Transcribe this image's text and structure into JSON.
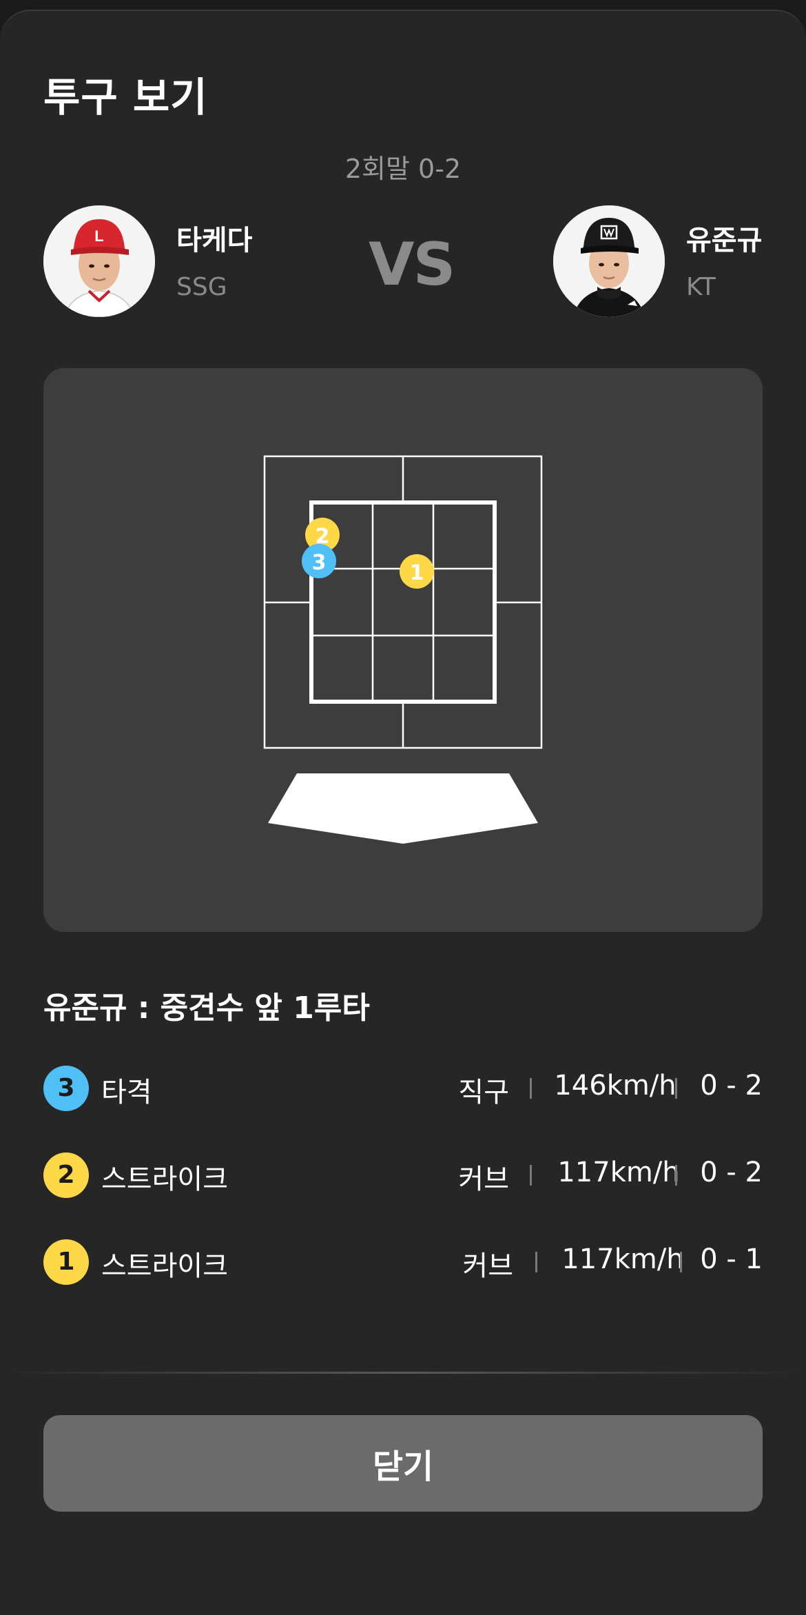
{
  "header": {
    "title": "투구 보기",
    "inning_score": "2회말 0-2"
  },
  "pitcher": {
    "name": "타케다",
    "team": "SSG"
  },
  "vs_label": "VS",
  "batter": {
    "name": "유준규",
    "team": "KT"
  },
  "zone_markers": [
    {
      "number": "2",
      "color": "#ffd848"
    },
    {
      "number": "3",
      "color": "#4fbff5"
    },
    {
      "number": "1",
      "color": "#ffd848"
    }
  ],
  "result_text": "유준규 : 중견수 앞 1루타",
  "pitches": [
    {
      "number": "3",
      "label": "타격",
      "type": "직구",
      "speed": "146km/h",
      "count": "0 - 2",
      "color": "#4fbff5"
    },
    {
      "number": "2",
      "label": "스트라이크",
      "type": "커브",
      "speed": "117km/h",
      "count": "0 - 2",
      "color": "#ffd848"
    },
    {
      "number": "1",
      "label": "스트라이크",
      "type": "커브",
      "speed": "117km/h",
      "count": "0 - 1",
      "color": "#ffd848"
    }
  ],
  "close_button": "닫기",
  "colors": {
    "background": "#262626",
    "panel": "#3d3d3d",
    "button": "#6b6b6b",
    "ball": "#4fbff5",
    "strike": "#ffd848"
  }
}
